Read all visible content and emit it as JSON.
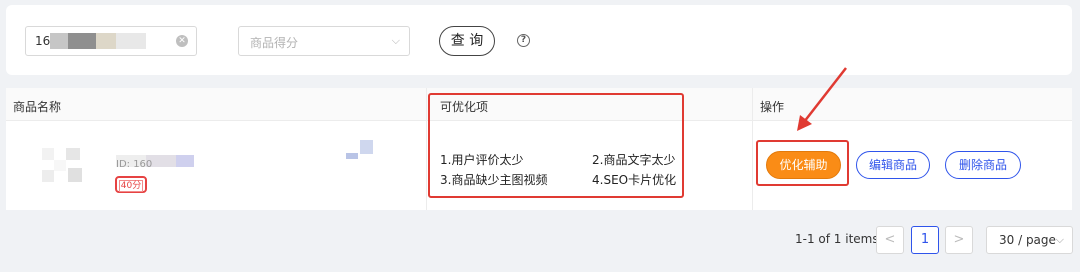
{
  "filters": {
    "search_value": "16",
    "score_placeholder": "商品得分",
    "query_label": "查 询",
    "help_symbol": "?"
  },
  "table": {
    "headers": {
      "name": "商品名称",
      "issues": "可优化项",
      "ops": "操作"
    },
    "rows": [
      {
        "product_id": "ID: 160",
        "score": "40分",
        "issues": [
          "1.用户评价太少",
          "2.商品文字太少",
          "3.商品缺少主图视频",
          "4.SEO卡片优化"
        ],
        "actions": {
          "optimize": "优化辅助",
          "edit": "编辑商品",
          "delete": "删除商品"
        }
      }
    ]
  },
  "pagination": {
    "summary": "1-1 of 1 items",
    "prev": "<",
    "current_page": "1",
    "next": ">",
    "page_size": "30 / page"
  },
  "colors": {
    "accent": "#2f54eb",
    "highlight": "#e03a32",
    "optimize": "#fa8c16"
  }
}
